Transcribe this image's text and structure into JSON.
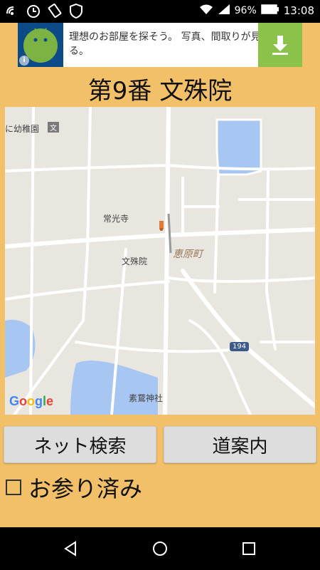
{
  "status_bar": {
    "battery": "96%",
    "time": "13:08",
    "icons_left": [
      "wifi-calling-icon",
      "alarm-icon",
      "rotation-icon",
      "shield-icon"
    ],
    "icons_right": [
      "wifi-icon",
      "signal-icon",
      "battery-icon"
    ]
  },
  "ad": {
    "text": "理想のお部屋を探そう。 写真、間取りが見れる。",
    "info": "i",
    "icons": [
      "android-robot-icon",
      "download-icon"
    ]
  },
  "title": "第9番 文殊院",
  "map": {
    "labels": {
      "kindergarten": "に幼稚園",
      "school_mark": "文",
      "joukouji": "常光寺",
      "monjuin": "文殊院",
      "town": "恵原町",
      "shrine": "素鵞神社",
      "route": "194"
    },
    "google": [
      "G",
      "o",
      "o",
      "g",
      "l",
      "e"
    ]
  },
  "buttons": {
    "search": "ネット検索",
    "guide": "道案内"
  },
  "visited": {
    "label": "お参り済み",
    "checked": false
  },
  "nav": [
    "back-icon",
    "home-icon",
    "recents-icon"
  ]
}
